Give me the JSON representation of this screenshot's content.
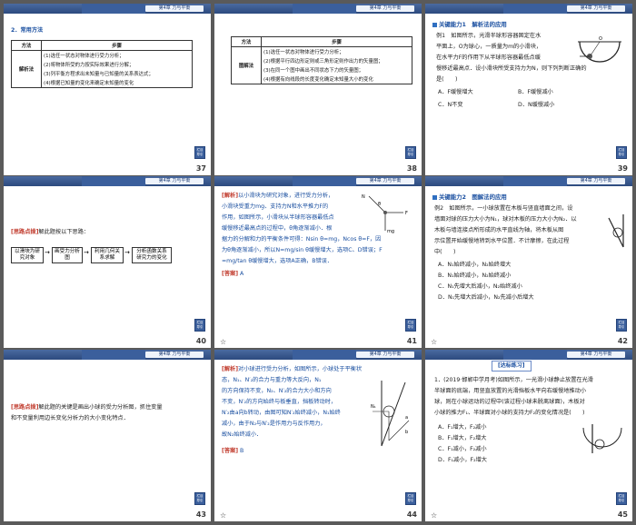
{
  "header_tab": "第4章  力与平衡",
  "s37": {
    "page": "37",
    "title": "2．常用方法",
    "col1": "方法",
    "col2": "步骤",
    "method": "解析法",
    "steps": [
      "(1)选任一状态对物体进行受力分析；",
      "(2)将物体所受的力按实际效果进行分解；",
      "(3)列平衡方程求出未知量与已知量的关系表达式；",
      "(4)根据已知量的变化来确定未知量的变化"
    ]
  },
  "s38": {
    "page": "38",
    "col1": "方法",
    "col2": "步骤",
    "method": "图解法",
    "steps": [
      "(1)选任一状态对物体进行受力分析；",
      "(2)根据平行四边形定则或三角形定则作出力的矢量图；",
      "(3)在同一个图中画出不同状态下力的矢量图；",
      "(4)根据有向线段的长度变化确定未知量大小的变化"
    ]
  },
  "s39": {
    "page": "39",
    "key": "关键能力1　解析法的应用",
    "lines": [
      "例1　如图所示，光滑半球形容器固定在水",
      "平面上，O为球心，一质量为m的小滑块，",
      "在水平力F的作用下从半球形容器最低点缓",
      "慢移近最高点．设小滑块所受支持力为N，则下列判断正确的",
      "是(　　)"
    ],
    "opts": [
      "A．F缓慢增大",
      "B．F缓慢减小",
      "C．N不变",
      "D．N缓慢减小"
    ]
  },
  "s40": {
    "page": "40",
    "tip_label": "[思路点拨]",
    "tip_text": "解此题按以下思路：",
    "flow": [
      "以滑块为研究对象",
      "画受力分析图",
      "利用几何关系求解",
      "分析函数关系研究力的变化"
    ]
  },
  "s41": {
    "page": "41",
    "jiexi": "[解析]",
    "lines": [
      "以小滑块为研究对象，进行受力分析，",
      "小滑块受重力mg、支持力N和水平推力F的",
      "作用，如图所示，小滑块从半球形容器最低点",
      "缓慢移近最高点的过程中，θ角逐渐减小．根",
      "据力的分解和力的平衡条件可得：Nsin θ=mg，Ncos θ=F，因",
      "为θ角逐渐减小，所以N=mg/sin θ缓慢增大，选项C、D错误；F",
      "=mg/tan θ缓慢增大，选项A正确，B错误．"
    ],
    "ans_label": "[答案]",
    "ans": "A"
  },
  "s42": {
    "page": "42",
    "key": "关键能力2　图解法的应用",
    "lines": [
      "例2　如图所示，一小球放置在木板与竖直墙面之间，设",
      "墙面对球的压力大小为N₁，球对木板的压力大小为N₂．以",
      "木板与墙连接点所形成的水平直线为轴，将木板从图",
      "示位置开始缓慢地转到水平位置．不计摩擦，在此过程",
      "中(　　)"
    ],
    "opts": [
      "A．N₁始终减小，N₂始终增大",
      "B．N₁始终减小，N₂始终减小",
      "C．N₁先增大后减小，N₂始终减小",
      "D．N₁先增大后减小，N₂先减小后增大"
    ]
  },
  "s43": {
    "page": "43",
    "tip_label": "[思路点拨]",
    "lines": [
      "解此题的关键是画出小球的受力分析图，抓住变量",
      "和不变量利用边长变化分析力的大小变化特点．"
    ]
  },
  "s44": {
    "page": "44",
    "jiexi": "[解析]",
    "lines": [
      "对小球进行受力分析，如图所示，小球处于平衡状",
      "态，N₁、N′₂的合力与重力等大反向，N₁",
      "的方向保持不变，N₂、N′₂的合力大小和方向",
      "不变，N′₂的方向始终与板垂直，挡板转动时，",
      "N′₂由a向b转动，由图可知N′₂始终减小，N₁始终",
      "减小，由于N₂与N′₂是作用力与反作用力，",
      "故N₂始终减小．"
    ],
    "ans_label": "[答案]",
    "ans": "B"
  },
  "s45": {
    "page": "45",
    "practice": "[达标练习]",
    "lines": [
      "1．(2019·邯郸中学月考)如图所示，一光滑小球静止放置在光滑",
      "半球面的底端，用竖直放置的光滑挡板水平向右缓慢地推动小",
      "球，则在小球运动的过程中(该过程小球未脱离球面)，木板对",
      "小球的推力F₁、半球面对小球的支持力F₂的变化情况是(　　)"
    ],
    "opts": [
      "A．F₁增大，F₂减小",
      "B．F₁增大，F₂增大",
      "C．F₁减小，F₂减小",
      "D．F₁减小，F₂增大"
    ]
  },
  "star_icon": "☆"
}
